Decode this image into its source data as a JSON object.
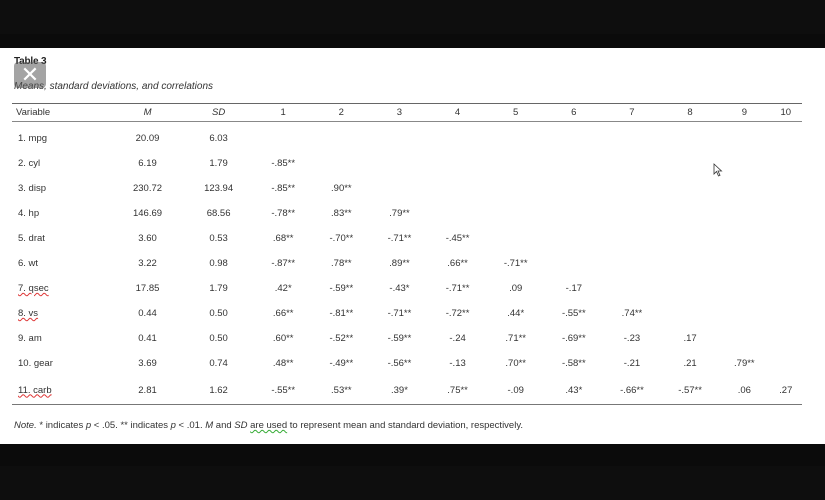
{
  "table": {
    "title": "Table 3",
    "caption": "Means, standard deviations, and correlations",
    "headers": [
      "Variable",
      "M",
      "SD",
      "1",
      "2",
      "3",
      "4",
      "5",
      "6",
      "7",
      "8",
      "9",
      "10"
    ],
    "rows": [
      [
        "1. mpg",
        "20.09",
        "6.03",
        "",
        "",
        "",
        "",
        "",
        "",
        "",
        "",
        "",
        ""
      ],
      [
        "2. cyl",
        "6.19",
        "1.79",
        "-.85**",
        "",
        "",
        "",
        "",
        "",
        "",
        "",
        "",
        ""
      ],
      [
        "3. disp",
        "230.72",
        "123.94",
        "-.85**",
        ".90**",
        "",
        "",
        "",
        "",
        "",
        "",
        "",
        ""
      ],
      [
        "4. hp",
        "146.69",
        "68.56",
        "-.78**",
        ".83**",
        ".79**",
        "",
        "",
        "",
        "",
        "",
        "",
        ""
      ],
      [
        "5. drat",
        "3.60",
        "0.53",
        ".68**",
        "-.70**",
        "-.71**",
        "-.45**",
        "",
        "",
        "",
        "",
        "",
        ""
      ],
      [
        "6. wt",
        "3.22",
        "0.98",
        "-.87**",
        ".78**",
        ".89**",
        ".66**",
        "-.71**",
        "",
        "",
        "",
        "",
        ""
      ],
      [
        "7. qsec",
        "17.85",
        "1.79",
        ".42*",
        "-.59**",
        "-.43*",
        "-.71**",
        ".09",
        "-.17",
        "",
        "",
        "",
        ""
      ],
      [
        "8. vs",
        "0.44",
        "0.50",
        ".66**",
        "-.81**",
        "-.71**",
        "-.72**",
        ".44*",
        "-.55**",
        ".74**",
        "",
        "",
        ""
      ],
      [
        "9. am",
        "0.41",
        "0.50",
        ".60**",
        "-.52**",
        "-.59**",
        "-.24",
        ".71**",
        "-.69**",
        "-.23",
        ".17",
        "",
        ""
      ],
      [
        "10. gear",
        "3.69",
        "0.74",
        ".48**",
        "-.49**",
        "-.56**",
        "-.13",
        ".70**",
        "-.58**",
        "-.21",
        ".21",
        ".79**",
        ""
      ],
      [
        "11. carb",
        "2.81",
        "1.62",
        "-.55**",
        ".53**",
        ".39*",
        ".75**",
        "-.09",
        ".43*",
        "-.66**",
        "-.57**",
        ".06",
        ".27"
      ]
    ],
    "note": {
      "label": "Note.",
      "part1": " * indicates ",
      "p1": "p",
      "part2": " < .05. ** indicates ",
      "p2": "p",
      "part3": " < .01. ",
      "m": "M",
      "part4": " and ",
      "sd": "SD",
      "part5": " ",
      "are_used": "are used",
      "part6": " to represent mean and standard deviation, respectively."
    }
  },
  "close_icon": "close-icon",
  "cursor_icon": "mouse-cursor-icon"
}
